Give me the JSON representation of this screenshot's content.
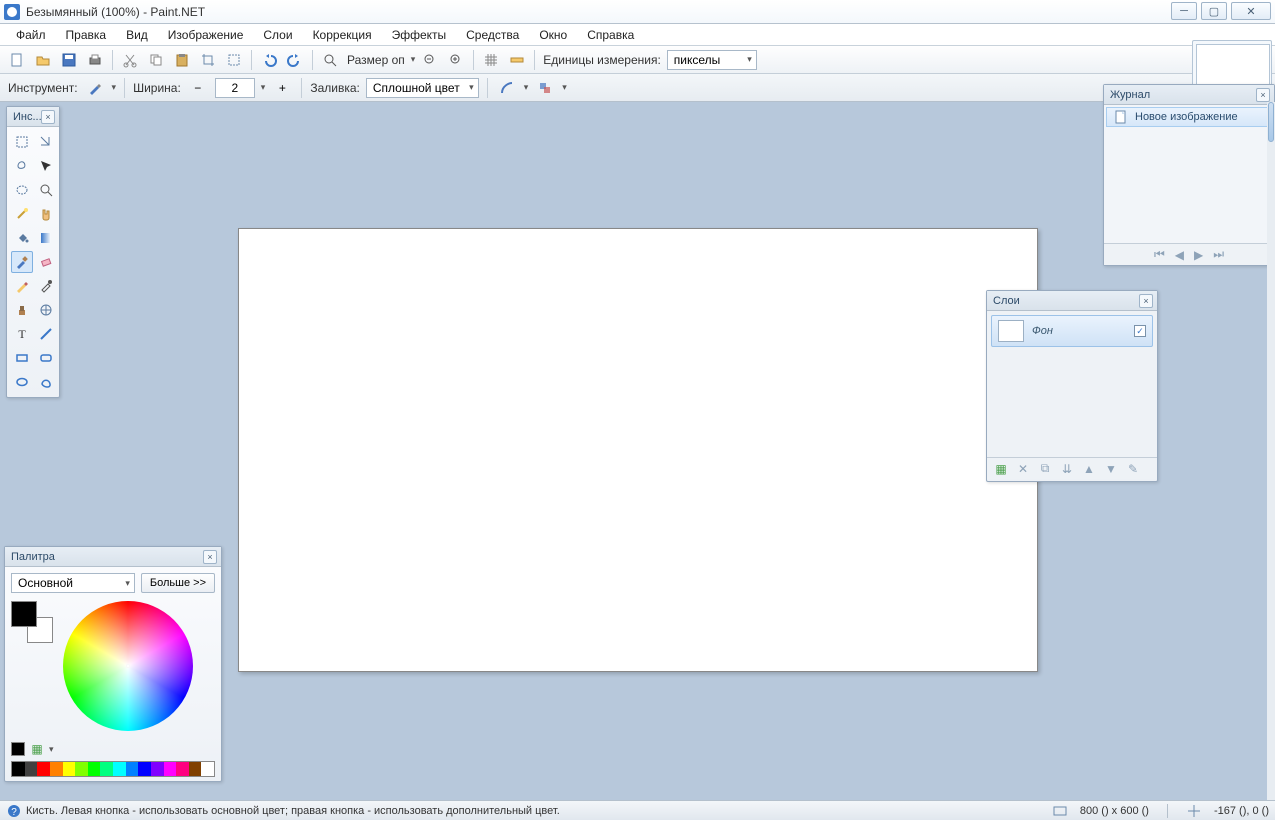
{
  "window": {
    "title": "Безымянный (100%) - Paint.NET"
  },
  "menu": {
    "items": [
      "Файл",
      "Правка",
      "Вид",
      "Изображение",
      "Слои",
      "Коррекция",
      "Эффекты",
      "Средства",
      "Окно",
      "Справка"
    ]
  },
  "toolbar": {
    "size_label": "Размер оп",
    "units_label": "Единицы измерения:",
    "units_value": "пикселы"
  },
  "options": {
    "tool_label": "Инструмент:",
    "width_label": "Ширина:",
    "width_value": "2",
    "fill_label": "Заливка:",
    "fill_value": "Сплошной цвет"
  },
  "tools": {
    "title": "Инс...",
    "items": [
      "rectangle-select",
      "move-selection",
      "lasso-select",
      "move-pixels",
      "ellipse-select",
      "zoom",
      "magic-wand",
      "pan",
      "paint-bucket",
      "gradient",
      "brush",
      "eraser",
      "pencil",
      "color-picker",
      "clone-stamp",
      "recolor",
      "text",
      "line",
      "rectangle-shape",
      "rounded-rect",
      "ellipse-shape",
      "freeform-shape"
    ],
    "active": "brush"
  },
  "history": {
    "title": "Журнал",
    "item": "Новое изображение"
  },
  "layers": {
    "title": "Слои",
    "item_name": "Фон",
    "checked": true
  },
  "palette": {
    "title": "Палитра",
    "mode": "Основной",
    "more": "Больше >>",
    "colors": [
      "#000000",
      "#404040",
      "#ff0000",
      "#ff8000",
      "#ffff00",
      "#80ff00",
      "#00ff00",
      "#00ff80",
      "#00ffff",
      "#0080ff",
      "#0000ff",
      "#8000ff",
      "#ff00ff",
      "#ff0080",
      "#804000",
      "#ffffff"
    ]
  },
  "status": {
    "hint": "Кисть. Левая кнопка - использовать основной цвет; правая кнопка - использовать дополнительный цвет.",
    "canvas_size": "800 () x 600 ()",
    "cursor_pos": "-167 (), 0 ()"
  }
}
